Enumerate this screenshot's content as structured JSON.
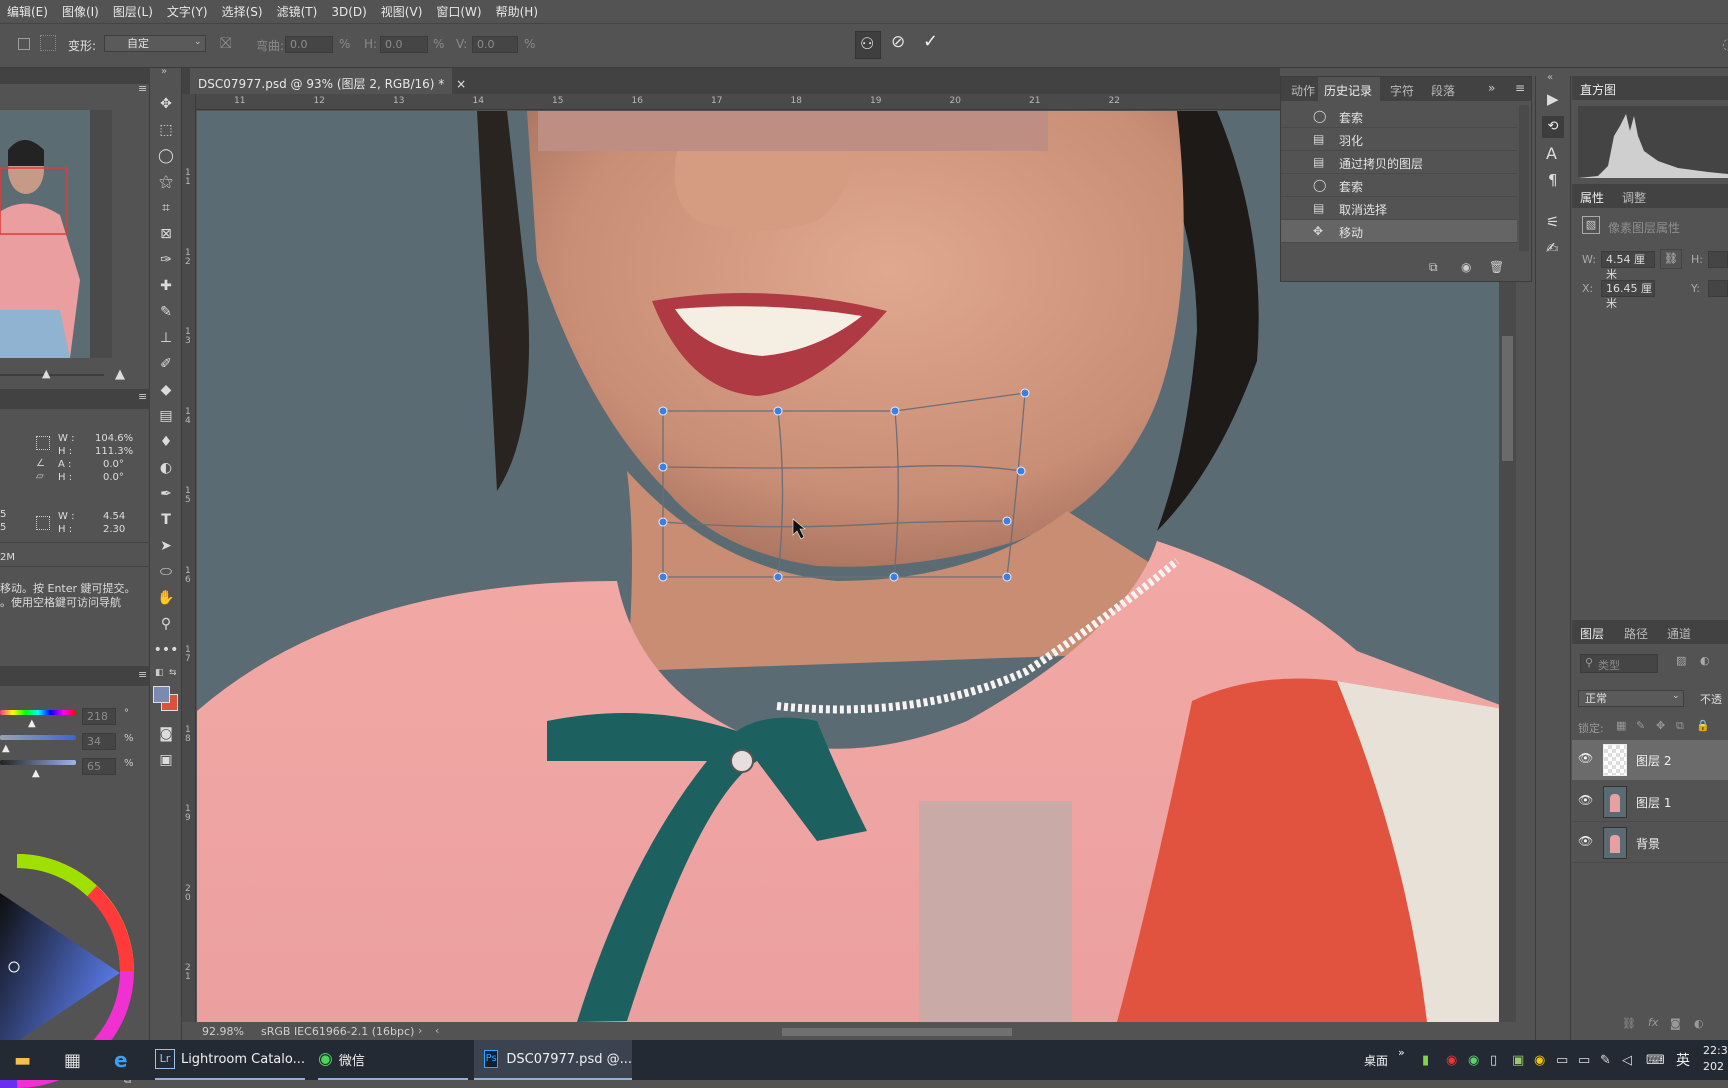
{
  "menu": [
    "编辑(E)",
    "图像(I)",
    "图层(L)",
    "文字(Y)",
    "选择(S)",
    "滤镜(T)",
    "3D(D)",
    "视图(V)",
    "窗口(W)",
    "帮助(H)"
  ],
  "options": {
    "transform_label": "变形:",
    "transform_value": "自定",
    "bend_label": "弯曲:",
    "bend_value": "0.0",
    "h_label": "H:",
    "h_value": "0.0",
    "v_label": "V:",
    "v_value": "0.0",
    "percent": "%"
  },
  "document": {
    "tab_title": "DSC07977.psd @ 93% (图层 2, RGB/16) *",
    "close": "×",
    "zoom": "92.98%",
    "profile": "sRGB IEC61966-2.1 (16bpc)",
    "ruler_top": [
      "11",
      "12",
      "13",
      "14",
      "15",
      "16",
      "17",
      "18",
      "19",
      "20",
      "21",
      "22"
    ],
    "ruler_left": [
      "1 1",
      "1 2",
      "1 3",
      "1 4",
      "1 5",
      "1 6",
      "1 7",
      "1 8",
      "1 9",
      "2 0",
      "2 1"
    ]
  },
  "info": {
    "w_pct": "104.6%",
    "h_pct": "111.3%",
    "a": "0.0°",
    "h_deg": "0.0°",
    "w": "4.54",
    "h": "2.30",
    "doc_size": "2M",
    "hint_line1": "移动。按 Enter 鍵可提交。",
    "hint_line2": "。使用空格鍵可访问导航"
  },
  "color": {
    "h_val": "218",
    "s_val": "34",
    "b_val": "65",
    "foreground": "#7b8ab0",
    "background": "#d8533a"
  },
  "history_panel": {
    "tabs": [
      "动作",
      "历史记录",
      "字符",
      "段落"
    ],
    "items": [
      {
        "icon": "lasso-icon",
        "label": "套索"
      },
      {
        "icon": "document-icon",
        "label": "羽化"
      },
      {
        "icon": "document-icon",
        "label": "通过拷贝的图层"
      },
      {
        "icon": "lasso-icon",
        "label": "套索"
      },
      {
        "icon": "document-icon",
        "label": "取消选择"
      },
      {
        "icon": "move-icon",
        "label": "移动"
      }
    ]
  },
  "histogram": {
    "title": "直方图"
  },
  "properties": {
    "tabs": [
      "属性",
      "调整"
    ],
    "subtitle": "像素图层属性",
    "w_label": "W:",
    "w_value": "4.54 厘米",
    "h_label": "H:",
    "x_label": "X:",
    "x_value": "16.45 厘米",
    "y_label": "Y:"
  },
  "layers_panel": {
    "tabs": [
      "图层",
      "路径",
      "通道"
    ],
    "search_placeholder": "类型",
    "blend_mode": "正常",
    "opacity_label": "不透",
    "lock_label": "锁定:",
    "layers": [
      {
        "name": "图层 2",
        "selected": true
      },
      {
        "name": "图层 1",
        "selected": false
      },
      {
        "name": "背景",
        "selected": false
      }
    ]
  },
  "taskbar": {
    "apps": [
      "Lightroom Catalo...",
      "微信",
      "DSC07977.psd @..."
    ],
    "desktop_label": "桌面",
    "ime": "英",
    "clock_time": "22:3",
    "clock_date": "202"
  }
}
